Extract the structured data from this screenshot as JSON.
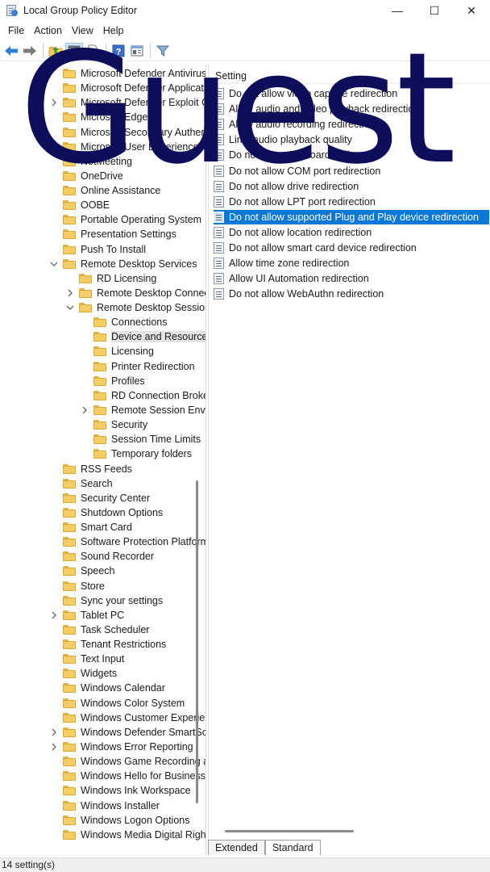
{
  "window": {
    "title": "Local Group Policy Editor",
    "controls": {
      "minimize": "—",
      "maximize": "☐",
      "close": "✕"
    }
  },
  "menu": [
    "File",
    "Action",
    "View",
    "Help"
  ],
  "toolbar": [
    "back-icon",
    "forward-icon",
    "up-folder-icon",
    "show-hide-tree-icon",
    "export-list-icon",
    "help-icon",
    "properties-icon",
    "filter-icon"
  ],
  "tree": {
    "items": [
      {
        "label": "Microsoft Defender Antivirus",
        "expander": "",
        "level": 0
      },
      {
        "label": "Microsoft Defender Application Guard",
        "expander": "",
        "level": 0
      },
      {
        "label": "Microsoft Defender Exploit Guard",
        "expander": ">",
        "level": 0
      },
      {
        "label": "Microsoft Edge",
        "expander": "",
        "level": 0
      },
      {
        "label": "Microsoft Secondary Authentication Factor",
        "expander": "",
        "level": 0
      },
      {
        "label": "Microsoft User Experience Virtualization",
        "expander": ">",
        "level": 0
      },
      {
        "label": "NetMeeting",
        "expander": "",
        "level": 0
      },
      {
        "label": "OneDrive",
        "expander": "",
        "level": 0
      },
      {
        "label": "Online Assistance",
        "expander": "",
        "level": 0
      },
      {
        "label": "OOBE",
        "expander": "",
        "level": 0
      },
      {
        "label": "Portable Operating System",
        "expander": "",
        "level": 0
      },
      {
        "label": "Presentation Settings",
        "expander": "",
        "level": 0
      },
      {
        "label": "Push To Install",
        "expander": "",
        "level": 0
      },
      {
        "label": "Remote Desktop Services",
        "expander": "v",
        "level": 0
      },
      {
        "label": "RD Licensing",
        "expander": "",
        "level": 1
      },
      {
        "label": "Remote Desktop Connection Client",
        "expander": ">",
        "level": 1
      },
      {
        "label": "Remote Desktop Session Host",
        "expander": "v",
        "level": 1
      },
      {
        "label": "Connections",
        "expander": "",
        "level": 2
      },
      {
        "label": "Device and Resource Redirection",
        "expander": "",
        "level": 2,
        "selected": true
      },
      {
        "label": "Licensing",
        "expander": "",
        "level": 2
      },
      {
        "label": "Printer Redirection",
        "expander": "",
        "level": 2
      },
      {
        "label": "Profiles",
        "expander": "",
        "level": 2
      },
      {
        "label": "RD Connection Broker",
        "expander": "",
        "level": 2
      },
      {
        "label": "Remote Session Environment",
        "expander": ">",
        "level": 2
      },
      {
        "label": "Security",
        "expander": "",
        "level": 2
      },
      {
        "label": "Session Time Limits",
        "expander": "",
        "level": 2
      },
      {
        "label": "Temporary folders",
        "expander": "",
        "level": 2
      },
      {
        "label": "RSS Feeds",
        "expander": "",
        "level": 0
      },
      {
        "label": "Search",
        "expander": "",
        "level": 0
      },
      {
        "label": "Security Center",
        "expander": "",
        "level": 0
      },
      {
        "label": "Shutdown Options",
        "expander": "",
        "level": 0
      },
      {
        "label": "Smart Card",
        "expander": "",
        "level": 0
      },
      {
        "label": "Software Protection Platform",
        "expander": "",
        "level": 0
      },
      {
        "label": "Sound Recorder",
        "expander": "",
        "level": 0
      },
      {
        "label": "Speech",
        "expander": "",
        "level": 0
      },
      {
        "label": "Store",
        "expander": "",
        "level": 0
      },
      {
        "label": "Sync your settings",
        "expander": "",
        "level": 0
      },
      {
        "label": "Tablet PC",
        "expander": ">",
        "level": 0
      },
      {
        "label": "Task Scheduler",
        "expander": "",
        "level": 0
      },
      {
        "label": "Tenant Restrictions",
        "expander": "",
        "level": 0
      },
      {
        "label": "Text Input",
        "expander": "",
        "level": 0
      },
      {
        "label": "Widgets",
        "expander": "",
        "level": 0
      },
      {
        "label": "Windows Calendar",
        "expander": "",
        "level": 0
      },
      {
        "label": "Windows Color System",
        "expander": "",
        "level": 0
      },
      {
        "label": "Windows Customer Experience Improvement Program",
        "expander": "",
        "level": 0
      },
      {
        "label": "Windows Defender SmartScreen",
        "expander": ">",
        "level": 0
      },
      {
        "label": "Windows Error Reporting",
        "expander": ">",
        "level": 0
      },
      {
        "label": "Windows Game Recording and Broadcasting",
        "expander": "",
        "level": 0
      },
      {
        "label": "Windows Hello for Business",
        "expander": "",
        "level": 0
      },
      {
        "label": "Windows Ink Workspace",
        "expander": "",
        "level": 0
      },
      {
        "label": "Windows Installer",
        "expander": "",
        "level": 0
      },
      {
        "label": "Windows Logon Options",
        "expander": "",
        "level": 0
      },
      {
        "label": "Windows Media Digital Rights Management",
        "expander": "",
        "level": 0
      }
    ]
  },
  "settings": {
    "column_header": "Setting",
    "items": [
      {
        "label": "Do not allow video capture redirection"
      },
      {
        "label": "Allow audio and video playback redirection"
      },
      {
        "label": "Allow audio recording redirection"
      },
      {
        "label": "Limit audio playback quality"
      },
      {
        "label": "Do not allow Clipboard redirection"
      },
      {
        "label": "Do not allow COM port redirection"
      },
      {
        "label": "Do not allow drive redirection"
      },
      {
        "label": "Do not allow LPT port redirection"
      },
      {
        "label": "Do not allow supported Plug and Play device redirection",
        "selected": true
      },
      {
        "label": "Do not allow location redirection"
      },
      {
        "label": "Do not allow smart card device redirection"
      },
      {
        "label": "Allow time zone redirection"
      },
      {
        "label": "Allow UI Automation redirection"
      },
      {
        "label": "Do not allow WebAuthn redirection"
      }
    ]
  },
  "tabs": [
    "Extended",
    "Standard"
  ],
  "active_tab": "Standard",
  "status": "14 setting(s)",
  "watermark": "Guest",
  "colors": {
    "selection": "#0a78d7",
    "watermark": "#0d0d5c",
    "folder": "#f5cd62"
  }
}
